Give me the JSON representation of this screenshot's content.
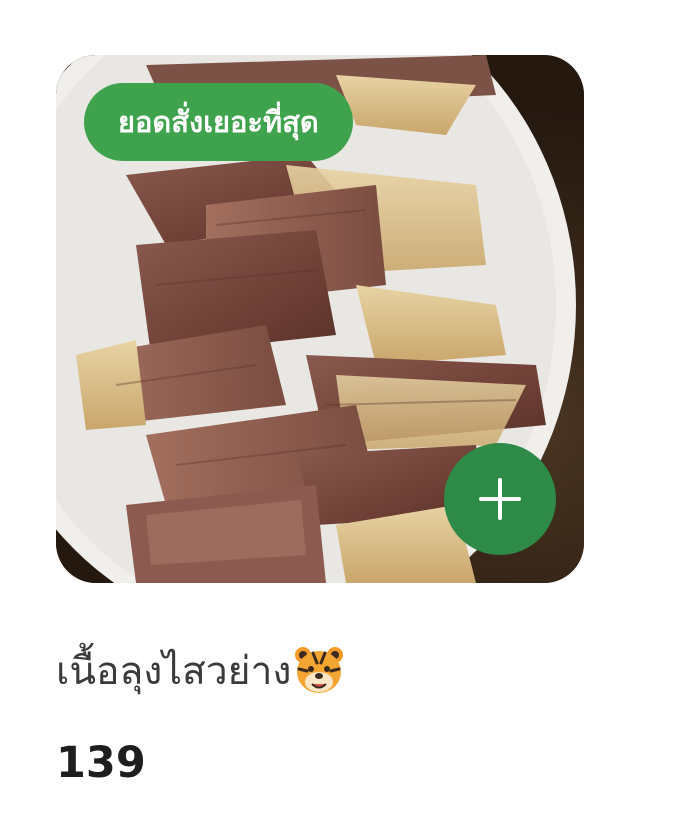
{
  "product": {
    "badge_label": "ยอดสั่งเยอะที่สุด",
    "name": "เนื้อลุงไสวย่าง",
    "name_icon": "tiger-face-icon",
    "price": "139",
    "image_alt": "grilled beef slices on a white plate",
    "add_icon": "plus-icon"
  },
  "colors": {
    "badge_bg": "#3fa34d",
    "add_button_bg": "#2e8b47",
    "text_primary": "#1e1e1e",
    "text_secondary": "#3a3a3a"
  }
}
